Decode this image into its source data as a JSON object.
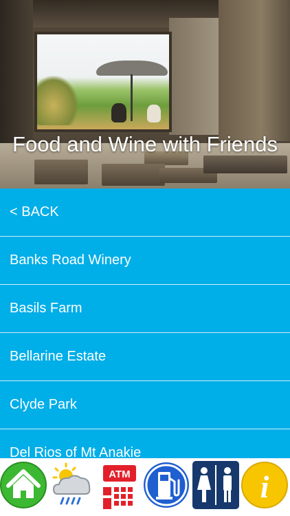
{
  "hero": {
    "title": "Food and Wine with Friends"
  },
  "list": {
    "back_label": "< BACK",
    "items": [
      "Banks Road Winery",
      "Basils Farm",
      "Bellarine Estate",
      "Clyde Park",
      "Del Rios of Mt Anakie"
    ]
  },
  "toolbar": {
    "items": [
      {
        "icon": "home-icon"
      },
      {
        "icon": "weather-icon"
      },
      {
        "icon": "atm-icon",
        "label": "ATM"
      },
      {
        "icon": "fuel-icon"
      },
      {
        "icon": "toilets-icon"
      },
      {
        "icon": "info-icon",
        "label": "i"
      }
    ]
  },
  "colors": {
    "list_bg": "#00aee8",
    "list_text": "#ffffff",
    "home_green": "#3cb832",
    "atm_red": "#e3202a",
    "fuel_blue": "#1f5fd0",
    "toilets_navy": "#17386c",
    "info_yellow": "#f7c600"
  }
}
